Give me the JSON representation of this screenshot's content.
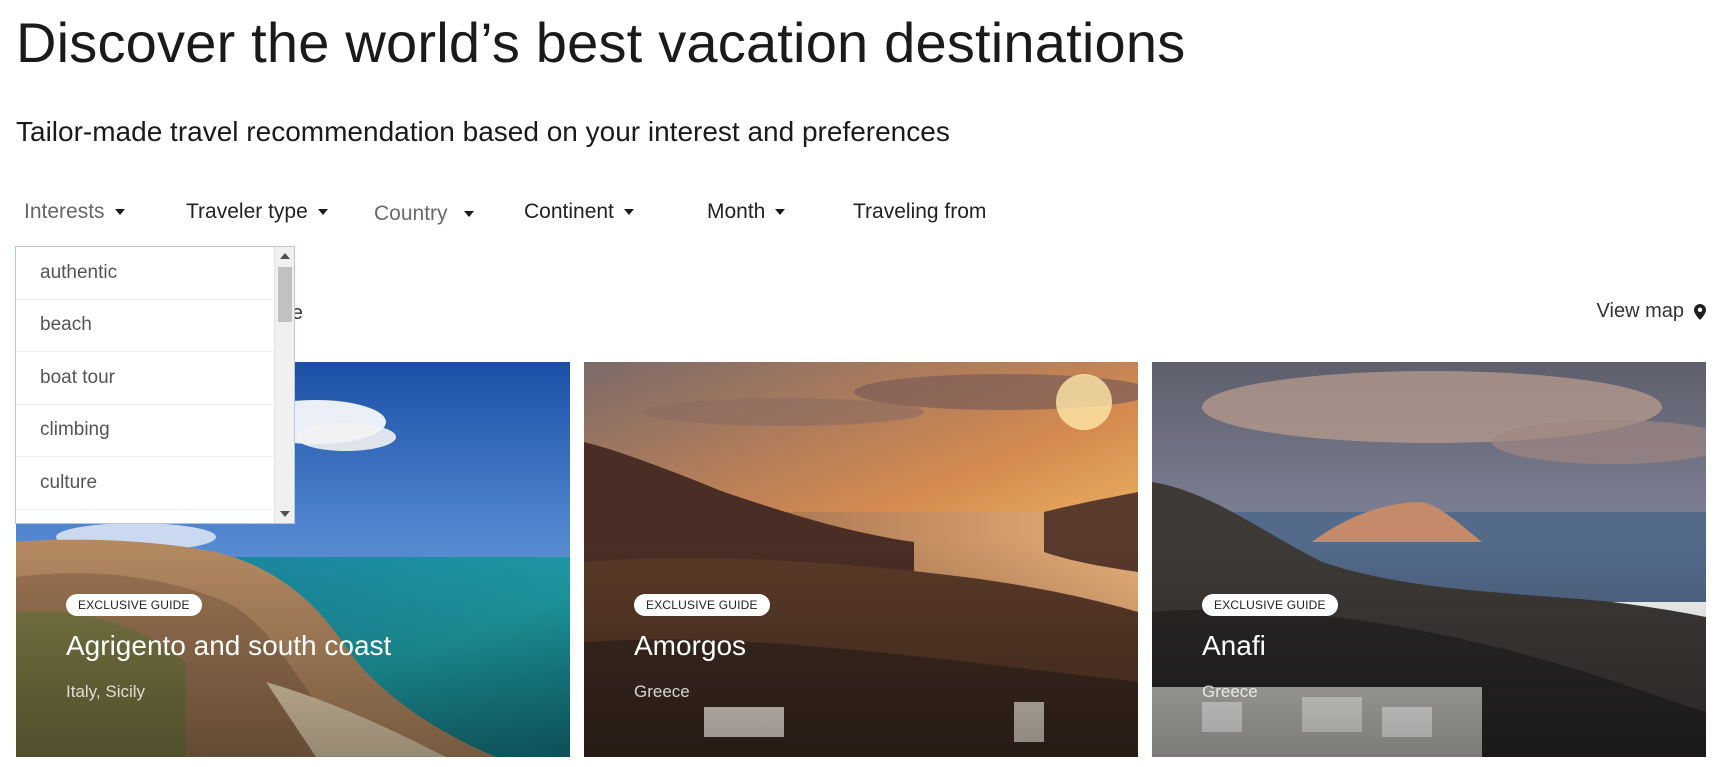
{
  "header": {
    "title": "Discover the world’s best vacation destinations",
    "subtitle": "Tailor-made travel recommendation based on your interest and preferences"
  },
  "filters": [
    {
      "label": "Interests",
      "icon": "chevron-down-icon"
    },
    {
      "label": "Traveler type",
      "icon": "chevron-down-icon"
    },
    {
      "label": "Country",
      "icon": "chevron-down-icon"
    },
    {
      "label": "Continent",
      "icon": "chevron-down-icon"
    },
    {
      "label": "Month",
      "icon": "chevron-down-icon"
    },
    {
      "label": "Traveling from"
    }
  ],
  "interests_dropdown": {
    "items": [
      "authentic",
      "beach",
      "boat tour",
      "climbing",
      "culture"
    ]
  },
  "sort": {
    "partial_text": "ore"
  },
  "view_map": {
    "label": "View map",
    "icon": "map-pin-icon"
  },
  "cards": [
    {
      "badge": "EXCLUSIVE GUIDE",
      "name": "Agrigento and south coast",
      "location": "Italy, Sicily"
    },
    {
      "badge": "EXCLUSIVE GUIDE",
      "name": "Amorgos",
      "location": "Greece"
    },
    {
      "badge": "EXCLUSIVE GUIDE",
      "name": "Anafi",
      "location": "Greece"
    }
  ],
  "colors": {
    "text": "#1a1a1a",
    "dropdown_border": "#b9c8d8",
    "sea": "#1f8fa8",
    "sunset": "#e8a04a"
  }
}
